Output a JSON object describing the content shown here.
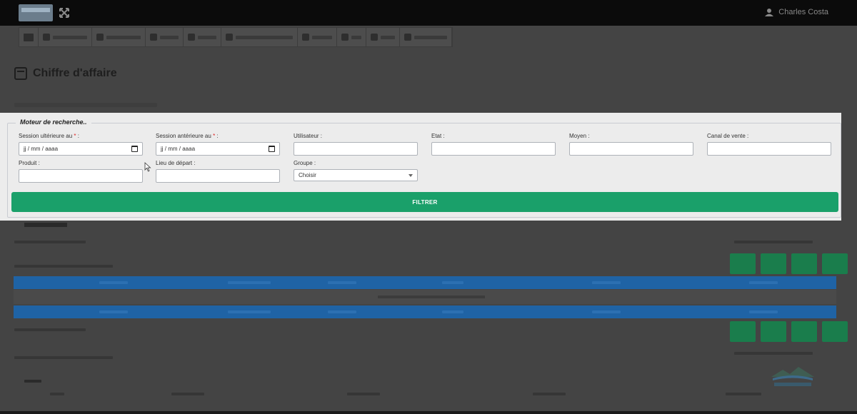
{
  "header": {
    "user_name": "Charles Costa"
  },
  "page": {
    "title": "Chiffre d'affaire"
  },
  "search": {
    "legend": "Moteur de recherche..",
    "fields": {
      "session_ulterieure": {
        "label": "Session ultérieure au",
        "placeholder": "jj / mm / aaaa",
        "required_mark": "*",
        "suffix": " :"
      },
      "session_anterieure": {
        "label": "Session antérieure au",
        "placeholder": "jj / mm / aaaa",
        "required_mark": "*",
        "suffix": " :"
      },
      "utilisateur": {
        "label": "Utilisateur :",
        "value": ""
      },
      "etat": {
        "label": "Etat :",
        "value": ""
      },
      "moyen": {
        "label": "Moyen :",
        "value": ""
      },
      "canal_de_vente": {
        "label": "Canal de vente :",
        "value": ""
      },
      "produit": {
        "label": "Produit :",
        "value": ""
      },
      "lieu_de_depart": {
        "label": "Lieu de départ :",
        "value": ""
      },
      "groupe": {
        "label": "Groupe :",
        "selected": "Choisir"
      }
    },
    "filter_button": "FILTRER"
  },
  "colors": {
    "filter_button": "#1aa06a",
    "table_header": "#1f63a5",
    "pager_button": "#1a7d4c"
  }
}
